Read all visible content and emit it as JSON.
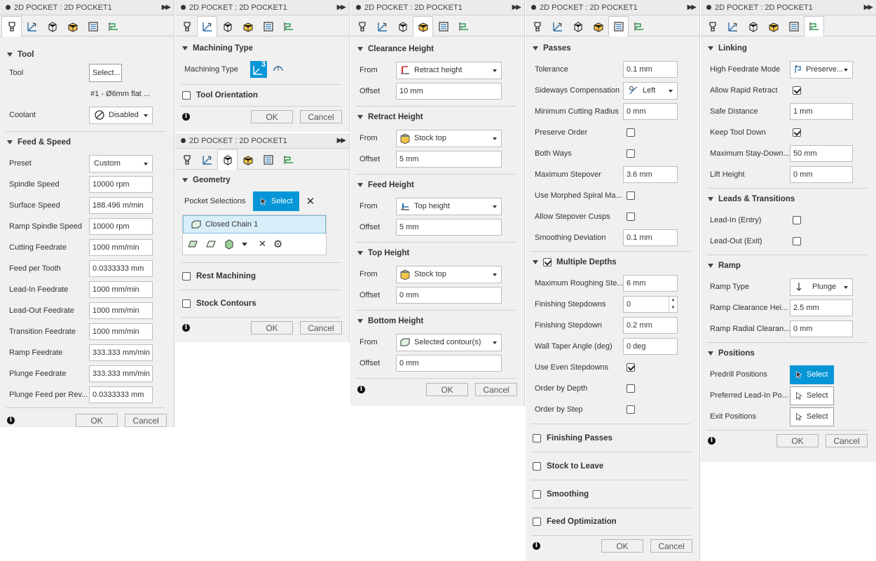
{
  "panel_title": "2D POCKET : 2D POCKET1",
  "buttons": {
    "ok": "OK",
    "cancel": "Cancel"
  },
  "tool_panel": {
    "tool_section": "Tool",
    "tool_label": "Tool",
    "tool_button": "Select...",
    "tool_name": "#1 - Ø6mm flat ...",
    "coolant_label": "Coolant",
    "coolant_value": "Disabled",
    "feed_section": "Feed & Speed",
    "preset_label": "Preset",
    "preset_value": "Custom",
    "fields": [
      {
        "label": "Spindle Speed",
        "value": "10000 rpm"
      },
      {
        "label": "Surface Speed",
        "value": "188.496 m/min"
      },
      {
        "label": "Ramp Spindle Speed",
        "value": "10000 rpm"
      },
      {
        "label": "Cutting Feedrate",
        "value": "1000 mm/min"
      },
      {
        "label": "Feed per Tooth",
        "value": "0.0333333 mm"
      },
      {
        "label": "Lead-In Feedrate",
        "value": "1000 mm/min"
      },
      {
        "label": "Lead-Out Feedrate",
        "value": "1000 mm/min"
      },
      {
        "label": "Transition Feedrate",
        "value": "1000 mm/min"
      },
      {
        "label": "Ramp Feedrate",
        "value": "333.333 mm/min"
      },
      {
        "label": "Plunge Feedrate",
        "value": "333.333 mm/min"
      },
      {
        "label": "Plunge Feed per Rev...",
        "value": "0.0333333 mm"
      }
    ]
  },
  "machining_panel": {
    "section": "Machining Type",
    "label": "Machining Type",
    "badge": "3",
    "orientation": "Tool Orientation"
  },
  "geometry_panel": {
    "section": "Geometry",
    "pocket_label": "Pocket Selections",
    "select": "Select",
    "chain": "Closed Chain 1",
    "rest": "Rest Machining",
    "stock": "Stock Contours"
  },
  "heights_panel": {
    "from": "From",
    "offset": "Offset",
    "sections": [
      {
        "title": "Clearance Height",
        "from": "Retract height",
        "offset": "10 mm"
      },
      {
        "title": "Retract Height",
        "from": "Stock top",
        "offset": "5 mm"
      },
      {
        "title": "Feed Height",
        "from": "Top height",
        "offset": "5 mm"
      },
      {
        "title": "Top Height",
        "from": "Stock top",
        "offset": "0 mm"
      },
      {
        "title": "Bottom Height",
        "from": "Selected contour(s)",
        "offset": "0 mm"
      }
    ]
  },
  "passes_panel": {
    "section": "Passes",
    "tolerance": {
      "label": "Tolerance",
      "value": "0.1 mm"
    },
    "sideways": {
      "label": "Sideways Compensation",
      "value": "Left"
    },
    "min_radius": {
      "label": "Minimum Cutting Radius",
      "value": "0 mm"
    },
    "preserve_order": "Preserve Order",
    "both_ways": "Both Ways",
    "max_stepover": {
      "label": "Maximum Stepover",
      "value": "3.6 mm"
    },
    "morphed": "Use Morphed Spiral Ma...",
    "cusps": "Allow Stepover Cusps",
    "smoothing_dev": {
      "label": "Smoothing Deviation",
      "value": "0.1 mm"
    },
    "multi_depths": "Multiple Depths",
    "max_rough": {
      "label": "Maximum Roughing Ste...",
      "value": "6 mm"
    },
    "fin_stepdowns": {
      "label": "Finishing Stepdowns",
      "value": "0"
    },
    "fin_stepdown": {
      "label": "Finishing Stepdown",
      "value": "0.2 mm"
    },
    "wall_taper": {
      "label": "Wall Taper Angle (deg)",
      "value": "0 deg"
    },
    "even": "Use Even Stepdowns",
    "by_depth": "Order by Depth",
    "by_step": "Order by Step",
    "finishing": "Finishing Passes",
    "leave": "Stock to Leave",
    "smoothing": "Smoothing",
    "feed_opt": "Feed Optimization"
  },
  "linking_panel": {
    "section": "Linking",
    "hf_mode": {
      "label": "High Feedrate Mode",
      "value": "Preserve..."
    },
    "rapid": "Allow Rapid Retract",
    "safe": {
      "label": "Safe Distance",
      "value": "1 mm"
    },
    "keep": "Keep Tool Down",
    "stay": {
      "label": "Maximum Stay-Down...",
      "value": "50 mm"
    },
    "lift": {
      "label": "Lift Height",
      "value": "0 mm"
    },
    "leads": "Leads & Transitions",
    "lead_in": "Lead-In (Entry)",
    "lead_out": "Lead-Out (Exit)",
    "ramp": "Ramp",
    "ramp_type": {
      "label": "Ramp Type",
      "value": "Plunge"
    },
    "ramp_clear": {
      "label": "Ramp Clearance Hei...",
      "value": "2.5 mm"
    },
    "ramp_radial": {
      "label": "Ramp Radial Clearan...",
      "value": "0 mm"
    },
    "positions": "Positions",
    "predrill": "Predrill Positions",
    "pref_lead": "Preferred Lead-In Po...",
    "exit": "Exit Positions",
    "select": "Select"
  },
  "colors": {
    "accent": "#0696d7",
    "panel": "#f0f0f0"
  }
}
